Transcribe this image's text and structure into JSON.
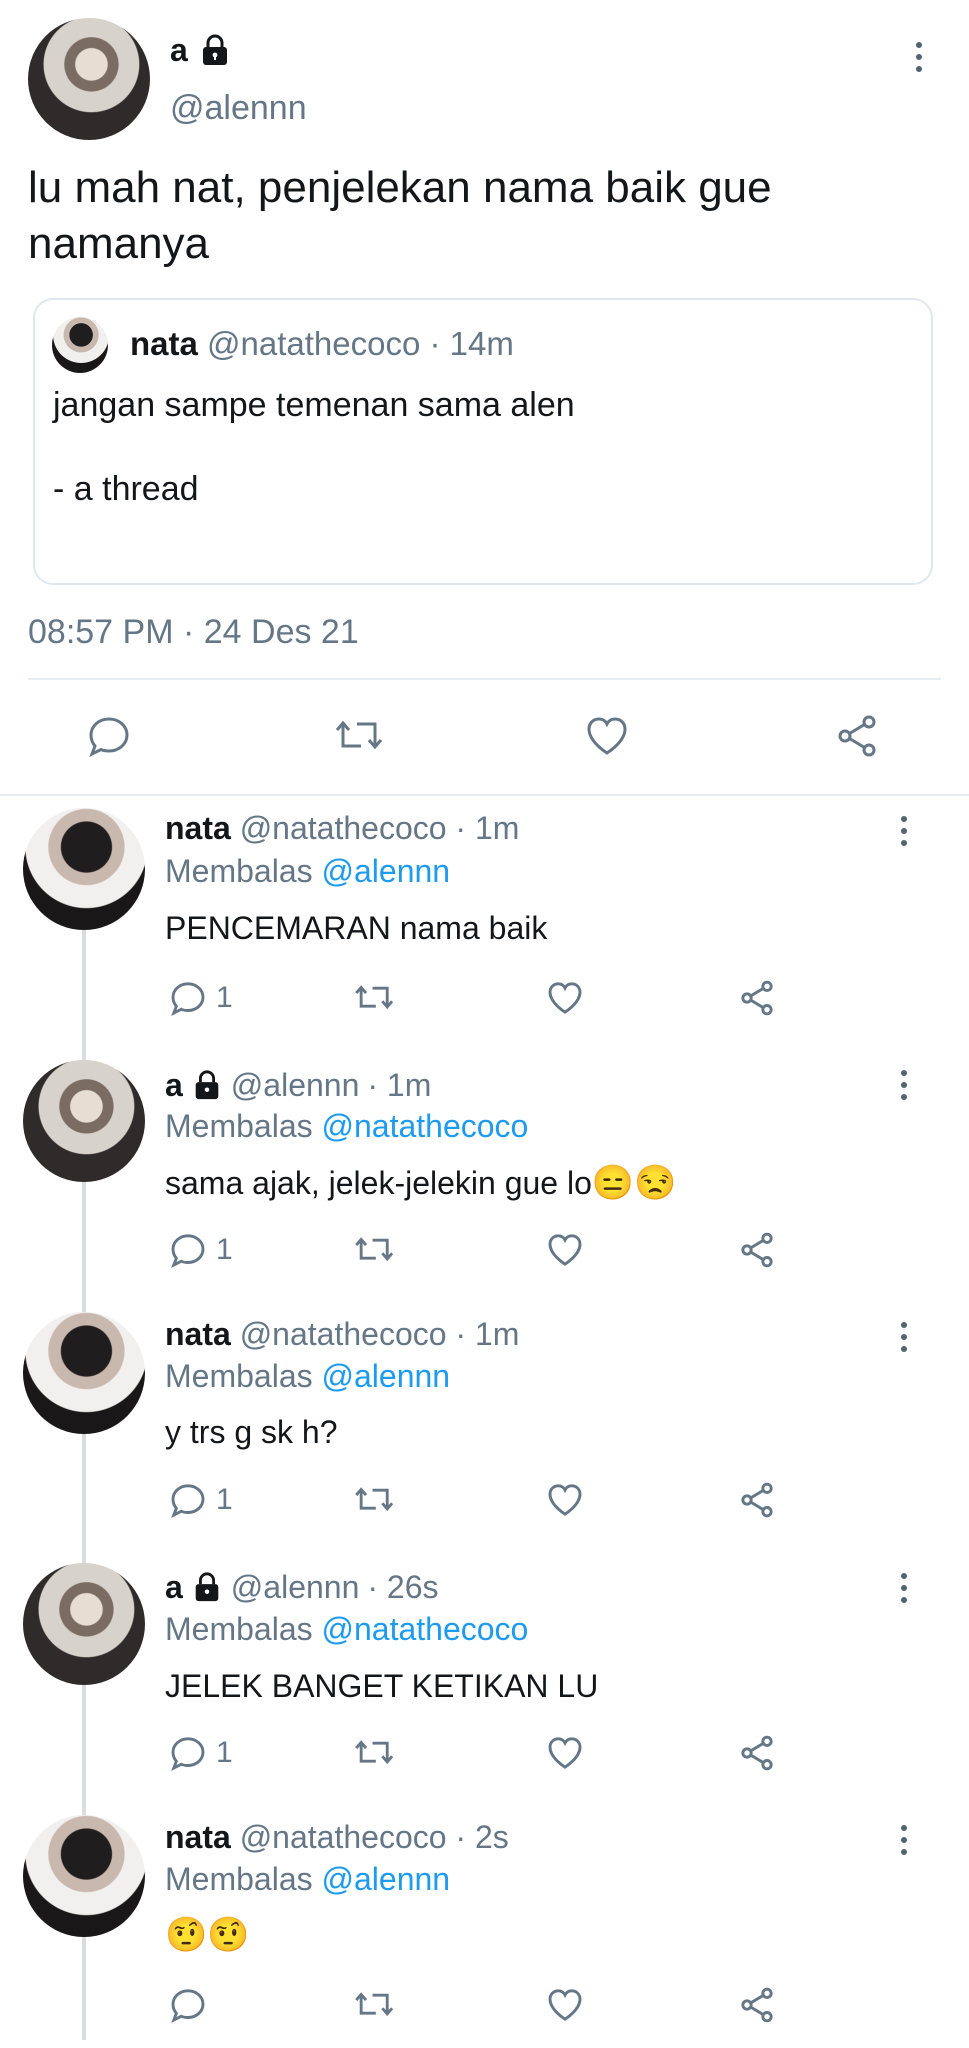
{
  "main_tweet": {
    "display_name": "a",
    "handle": "@alennn",
    "text_line1": "lu mah nat, penjelekan nama baik gue",
    "text_line2": "namanya",
    "timestamp": "08:57 PM · 24 Des 21",
    "quoted": {
      "display_name": "nata",
      "handle": "@natathecoco",
      "time": "· 14m",
      "line1": "jangan sampe temenan sama alen",
      "line2": "- a thread"
    }
  },
  "replies": [
    {
      "name": "nata",
      "handle": "@natathecoco",
      "time": "· 1m",
      "replying_prefix": "Membalas",
      "replying_to": "@alennn",
      "text": "PENCEMARAN nama baik",
      "reply_count": "1",
      "locked": false
    },
    {
      "name": "a",
      "handle": "@alennn",
      "time": "· 1m",
      "replying_prefix": "Membalas",
      "replying_to": "@natathecoco",
      "text": "sama ajak, jelek-jelekin gue lo",
      "emoji": "😑😒",
      "reply_count": "1",
      "locked": true
    },
    {
      "name": "nata",
      "handle": "@natathecoco",
      "time": "· 1m",
      "replying_prefix": "Membalas",
      "replying_to": "@alennn",
      "text": "y trs g sk h?",
      "reply_count": "1",
      "locked": false
    },
    {
      "name": "a",
      "handle": "@alennn",
      "time": "· 26s",
      "replying_prefix": "Membalas",
      "replying_to": "@natathecoco",
      "text": "JELEK BANGET KETIKAN LU",
      "reply_count": "1",
      "locked": true
    },
    {
      "name": "nata",
      "handle": "@natathecoco",
      "time": "· 2s",
      "replying_prefix": "Membalas",
      "replying_to": "@alennn",
      "text": "",
      "emoji": "🤨🤨",
      "reply_count": "",
      "locked": false
    }
  ],
  "icons": {
    "reply": "comment-icon",
    "retweet": "retweet-icon",
    "like": "heart-icon",
    "share": "share-icon",
    "more": "more-vertical-icon",
    "lock": "lock-icon"
  },
  "colors": {
    "link": "#1d9bf0",
    "muted": "#657786",
    "text": "#14171a"
  }
}
